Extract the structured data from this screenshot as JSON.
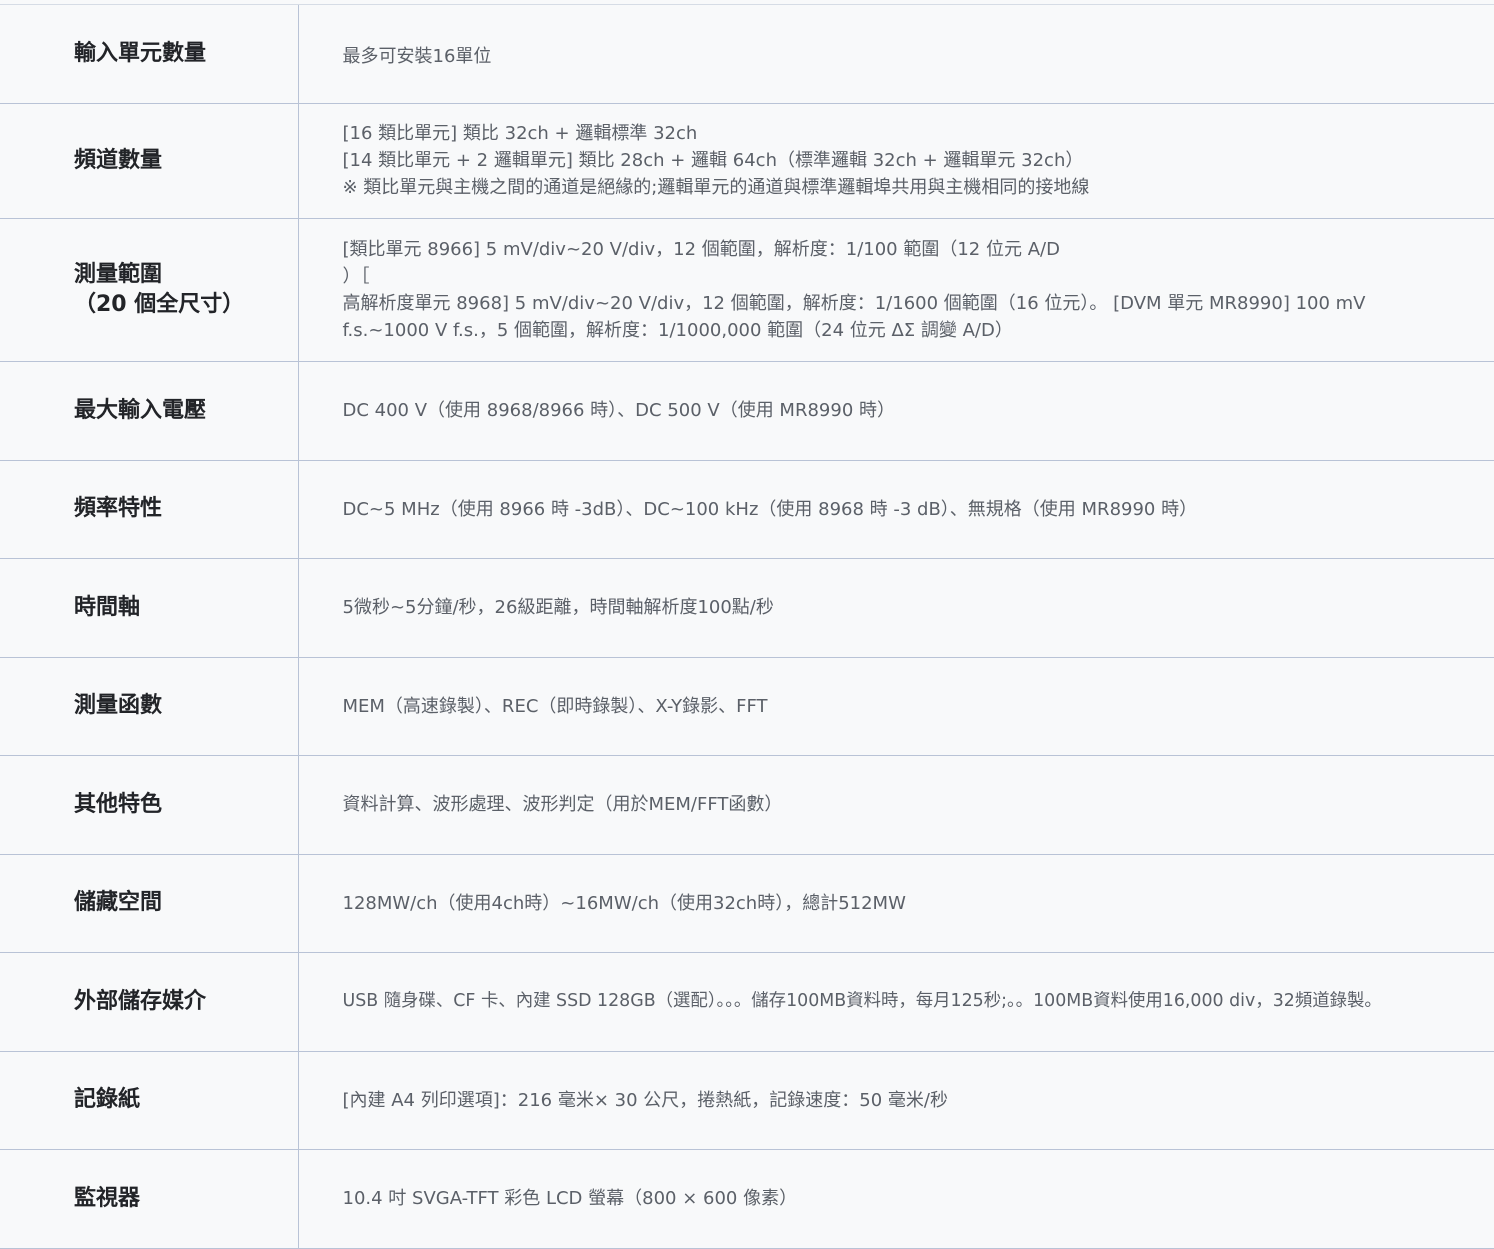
{
  "rows": [
    {
      "label": [
        "輸入單元數量"
      ],
      "value": [
        "最多可安裝16單位"
      ]
    },
    {
      "label": [
        "頻道數量"
      ],
      "value": [
        "[16 類比單元] 類比 32ch + 邏輯標準 32ch",
        "[14 類比單元 + 2 邏輯單元] 類比 28ch + 邏輯 64ch（標準邏輯 32ch + 邏輯單元 32ch）",
        "※ 類比單元與主機之間的通道是絕緣的;邏輯單元的通道與標準邏輯埠共用與主機相同的接地線"
      ]
    },
    {
      "label": [
        "測量範圍",
        "（20 個全尺寸）"
      ],
      "value": [
        "[類比單元 8966] 5 mV/div~20 V/div，12 個範圍，解析度：1/100 範圍（12 位元 A/D",
        "）［",
        "高解析度單元 8968] 5 mV/div~20 V/div，12 個範圍，解析度：1/1600 個範圍（16 位元）。 [DVM 單元 MR8990] 100 mV f.s.~1000 V f.s.，5 個範圍，解析度：1/1000,000 範圍（24 位元 ΔΣ 調變 A/D）"
      ]
    },
    {
      "label": [
        "最大輸入電壓"
      ],
      "value": [
        "DC 400 V（使用 8968/8966 時）、DC 500 V（使用 MR8990 時）"
      ]
    },
    {
      "label": [
        "頻率特性"
      ],
      "value": [
        "DC~5 MHz（使用 8966 時 -3dB）、DC~100 kHz（使用 8968 時 -3 dB）、無規格（使用 MR8990 時）"
      ]
    },
    {
      "label": [
        "時間軸"
      ],
      "value": [
        "5微秒~5分鐘/秒，26級距離，時間軸解析度100點/秒"
      ]
    },
    {
      "label": [
        "測量函數"
      ],
      "value": [
        "MEM（高速錄製）、REC（即時錄製）、X-Y錄影、FFT"
      ]
    },
    {
      "label": [
        "其他特色"
      ],
      "value": [
        "資料計算、波形處理、波形判定（用於MEM/FFT函數）"
      ]
    },
    {
      "label": [
        "儲藏空間"
      ],
      "value": [
        "128MW/ch（使用4ch時）~16MW/ch（使用32ch時），總計512MW"
      ]
    },
    {
      "label": [
        "外部儲存媒介"
      ],
      "value": [
        "USB 隨身碟、CF 卡、內建 SSD 128GB（選配）。。。儲存100MB資料時，每月125秒;。。100MB資料使用16,000 div，32頻道錄製。"
      ]
    },
    {
      "label": [
        "記錄紙"
      ],
      "value": [
        "[內建 A4 列印選項]：216 毫米× 30 公尺，捲熱紙，記錄速度：50 毫米/秒"
      ]
    },
    {
      "label": [
        "監視器"
      ],
      "value": [
        "10.4 吋 SVGA-TFT 彩色 LCD 螢幕（800 × 600 像素）"
      ]
    }
  ]
}
